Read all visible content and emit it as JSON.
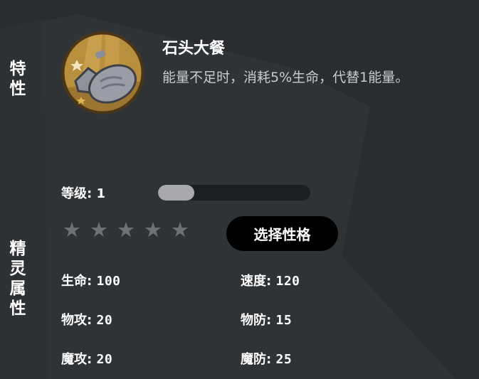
{
  "sections": {
    "trait_label": "特性",
    "attributes_label": "精灵属性"
  },
  "trait": {
    "icon": "stone-meal-icon",
    "title": "石头大餐",
    "description": "能量不足时，消耗5%生命，代替1能量。"
  },
  "level": {
    "label": "等级:",
    "value": "1",
    "progress_fraction": 0.24
  },
  "stars": {
    "filled": 0,
    "total": 5,
    "glyph": "★",
    "color": "#6f7175"
  },
  "nature_button": {
    "label": "选择性格"
  },
  "stats": {
    "hp": {
      "label": "生命:",
      "value": "100"
    },
    "speed": {
      "label": "速度:",
      "value": "120"
    },
    "phys_atk": {
      "label": "物攻:",
      "value": "20"
    },
    "phys_def": {
      "label": "物防:",
      "value": "15"
    },
    "magic_atk": {
      "label": "魔攻:",
      "value": "20"
    },
    "magic_def": {
      "label": "魔防:",
      "value": "25"
    }
  },
  "colors": {
    "background": "#2a2c2f",
    "panel_shape": "#313437",
    "bar_track": "#1d1e20",
    "bar_fill": "#a9a9ad",
    "description_text": "#c9cbce"
  }
}
